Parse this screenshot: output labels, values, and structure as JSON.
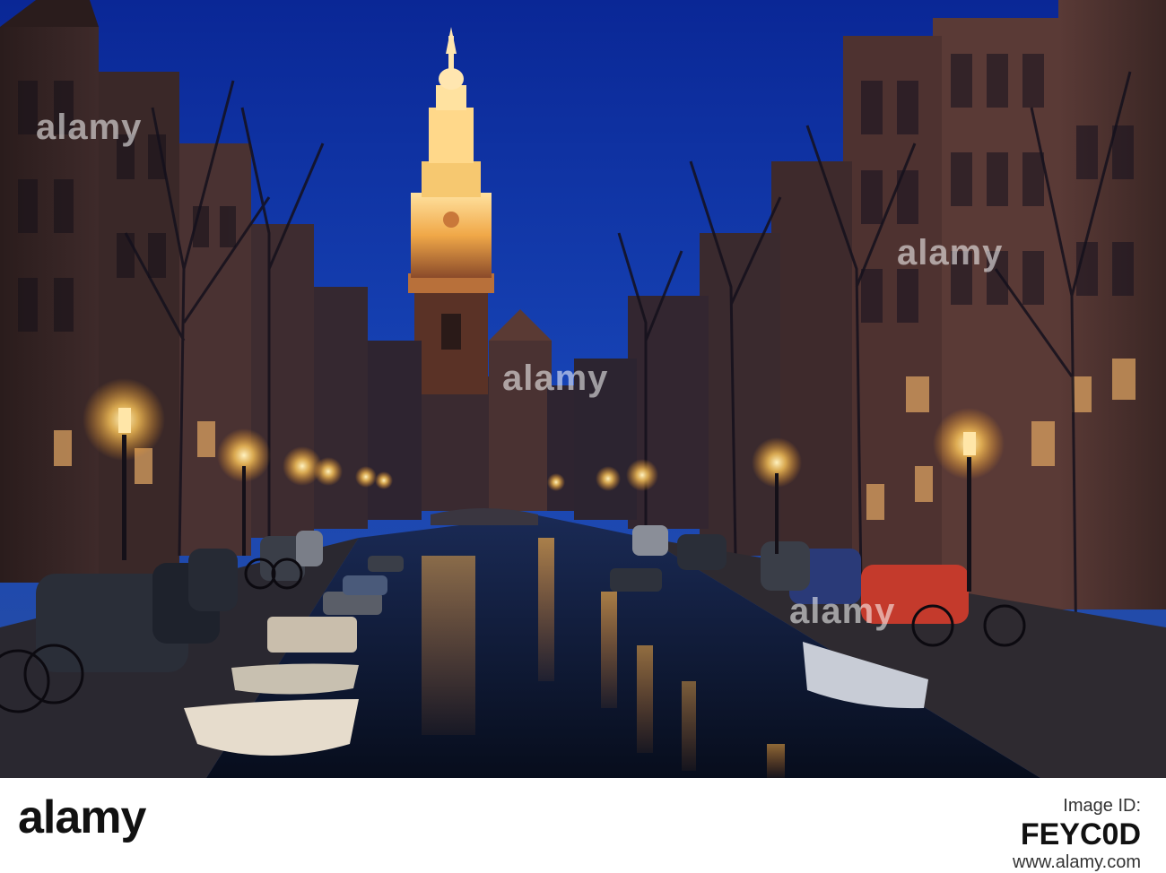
{
  "photo": {
    "description_colors": {
      "sky_top": "#0a2c9a",
      "sky_bottom": "#1c4fc2",
      "tower_light": "#f2b34a",
      "building_brick": "#3a2622",
      "water": "#0c1832",
      "lamp_glow": "#ffd27a"
    }
  },
  "watermark": {
    "text": "alamy"
  },
  "footer": {
    "logo_text": "alamy",
    "meta_label": "Image ID:",
    "image_id": "FEYC0D",
    "site": "www.alamy.com"
  }
}
